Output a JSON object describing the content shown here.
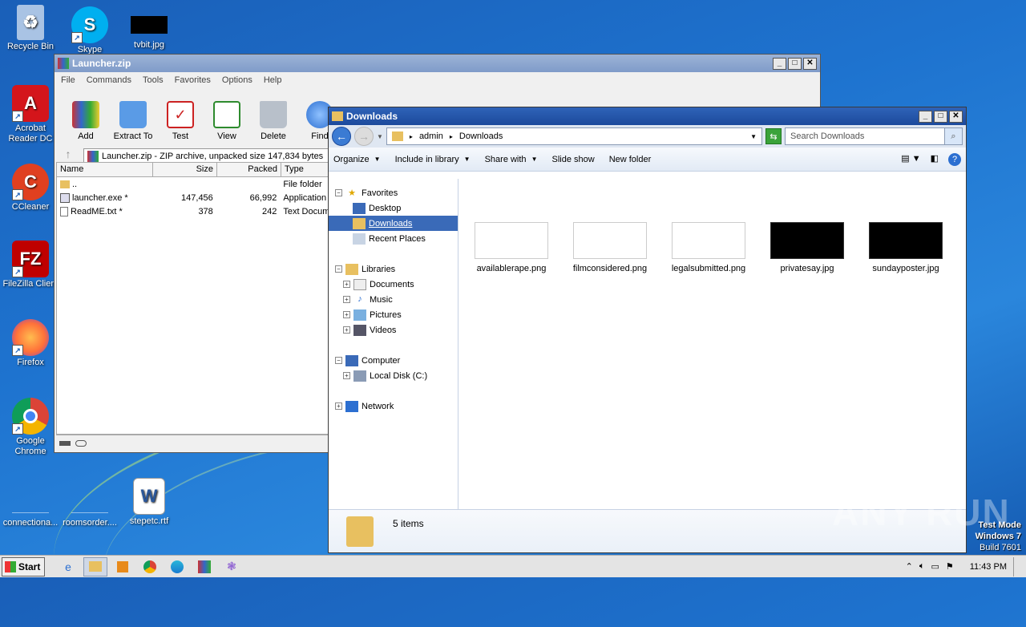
{
  "desktop": {
    "icons": [
      {
        "label": "Recycle Bin",
        "icon": "recycle-bin-icon",
        "color": "#7aa6d6"
      },
      {
        "label": "Skype",
        "icon": "skype-icon",
        "color": "#00aff0"
      },
      {
        "label": "tvbit.jpg",
        "icon": "image-file-icon",
        "color": "#000000"
      },
      {
        "label": "Acrobat Reader DC",
        "icon": "acrobat-icon",
        "color": "#d4151b"
      },
      {
        "label": "CCleaner",
        "icon": "ccleaner-icon",
        "color": "#e04020"
      },
      {
        "label": "FileZilla Client",
        "icon": "filezilla-icon",
        "color": "#bf0000"
      },
      {
        "label": "Firefox",
        "icon": "firefox-icon",
        "color": "#ff7139"
      },
      {
        "label": "Google Chrome",
        "icon": "chrome-icon",
        "color": "#4285f4"
      },
      {
        "label": "connectiona...",
        "icon": "blank-file-icon",
        "color": "#2a86dc"
      },
      {
        "label": "roomsorder....",
        "icon": "blank-file-icon",
        "color": "#2a86dc"
      },
      {
        "label": "stepetc.rtf",
        "icon": "word-doc-icon",
        "color": "#2b579a"
      }
    ]
  },
  "winrar": {
    "title": "Launcher.zip",
    "menu": [
      "File",
      "Commands",
      "Tools",
      "Favorites",
      "Options",
      "Help"
    ],
    "tools": [
      {
        "label": "Add",
        "icon": "add-archive-icon",
        "color": "#c83a3a"
      },
      {
        "label": "Extract To",
        "icon": "extract-folder-icon",
        "color": "#3a7bd5"
      },
      {
        "label": "Test",
        "icon": "test-clipboard-icon",
        "color": "#cc2222"
      },
      {
        "label": "View",
        "icon": "view-book-icon",
        "color": "#2e8b2e"
      },
      {
        "label": "Delete",
        "icon": "delete-bin-icon",
        "color": "#9aa4b0"
      },
      {
        "label": "Find",
        "icon": "find-magnifier-icon",
        "color": "#2c6fd1"
      }
    ],
    "path": "Launcher.zip - ZIP archive, unpacked size 147,834 bytes",
    "columns": [
      "Name",
      "Size",
      "Packed",
      "Type"
    ],
    "rows": [
      {
        "name": "..",
        "size": "",
        "packed": "",
        "type": "File folder",
        "icon": "folder-icon"
      },
      {
        "name": "launcher.exe *",
        "size": "147,456",
        "packed": "66,992",
        "type": "Application",
        "icon": "exe-icon"
      },
      {
        "name": "ReadME.txt *",
        "size": "378",
        "packed": "242",
        "type": "Text Document",
        "icon": "txt-icon"
      }
    ]
  },
  "explorer": {
    "title": "Downloads",
    "breadcrumb": [
      "admin",
      "Downloads"
    ],
    "search_placeholder": "Search Downloads",
    "commands": [
      "Organize",
      "Include in library",
      "Share with",
      "Slide show",
      "New folder"
    ],
    "nav": {
      "favorites": "Favorites",
      "favorites_items": [
        "Desktop",
        "Downloads",
        "Recent Places"
      ],
      "libraries": "Libraries",
      "libraries_items": [
        "Documents",
        "Music",
        "Pictures",
        "Videos"
      ],
      "computer": "Computer",
      "computer_items": [
        "Local Disk (C:)"
      ],
      "network": "Network"
    },
    "files": [
      {
        "name": "availablerape.png",
        "thumb": "light"
      },
      {
        "name": "filmconsidered.png",
        "thumb": "light"
      },
      {
        "name": "legalsubmitted.png",
        "thumb": "light"
      },
      {
        "name": "privatesay.jpg",
        "thumb": "dark"
      },
      {
        "name": "sundayposter.jpg",
        "thumb": "dark"
      }
    ],
    "status": "5 items"
  },
  "taskbar": {
    "start": "Start",
    "clock": "11:43 PM",
    "apps": [
      "ie-icon",
      "explorer-icon",
      "media-player-icon",
      "chrome-icon",
      "edge-icon",
      "winrar-icon",
      "generic-app-icon"
    ]
  },
  "overlay": {
    "watermark": "ANY RUN",
    "test_mode": "Test Mode",
    "os": "Windows 7",
    "build": "Build 7601"
  }
}
